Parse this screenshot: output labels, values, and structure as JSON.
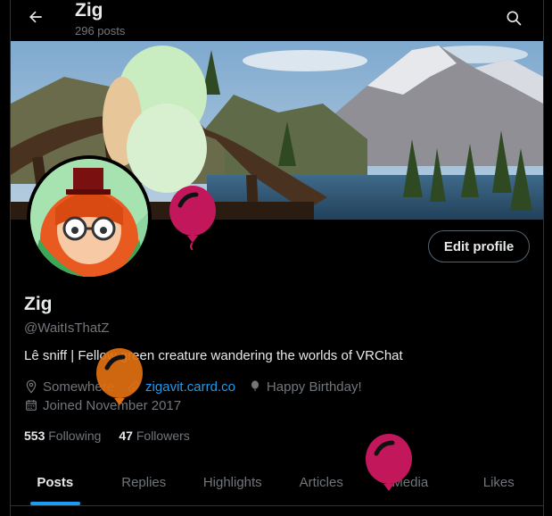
{
  "header": {
    "name": "Zig",
    "posts_count": "296 posts"
  },
  "profile": {
    "display_name": "Zig",
    "handle": "@WaitIsThatZ",
    "bio": "Lê sniff | Fellow green creature wandering the worlds of VRChat",
    "location": "Somewhere",
    "website": "zigavit.carrd.co",
    "birthday": "Happy Birthday!",
    "joined": "Joined November 2017",
    "edit_label": "Edit profile"
  },
  "stats": {
    "following_count": "553",
    "following_label": "Following",
    "followers_count": "47",
    "followers_label": "Followers"
  },
  "tabs": [
    {
      "label": "Posts",
      "active": true
    },
    {
      "label": "Replies"
    },
    {
      "label": "Highlights"
    },
    {
      "label": "Articles"
    },
    {
      "label": "Media"
    },
    {
      "label": "Likes"
    }
  ],
  "colors": {
    "accent": "#1d9bf0",
    "balloon_magenta": "#c2185b",
    "balloon_orange": "#e07010"
  },
  "icons": [
    "back-arrow-icon",
    "search-icon",
    "location-icon",
    "link-icon",
    "balloon-icon",
    "calendar-icon"
  ]
}
